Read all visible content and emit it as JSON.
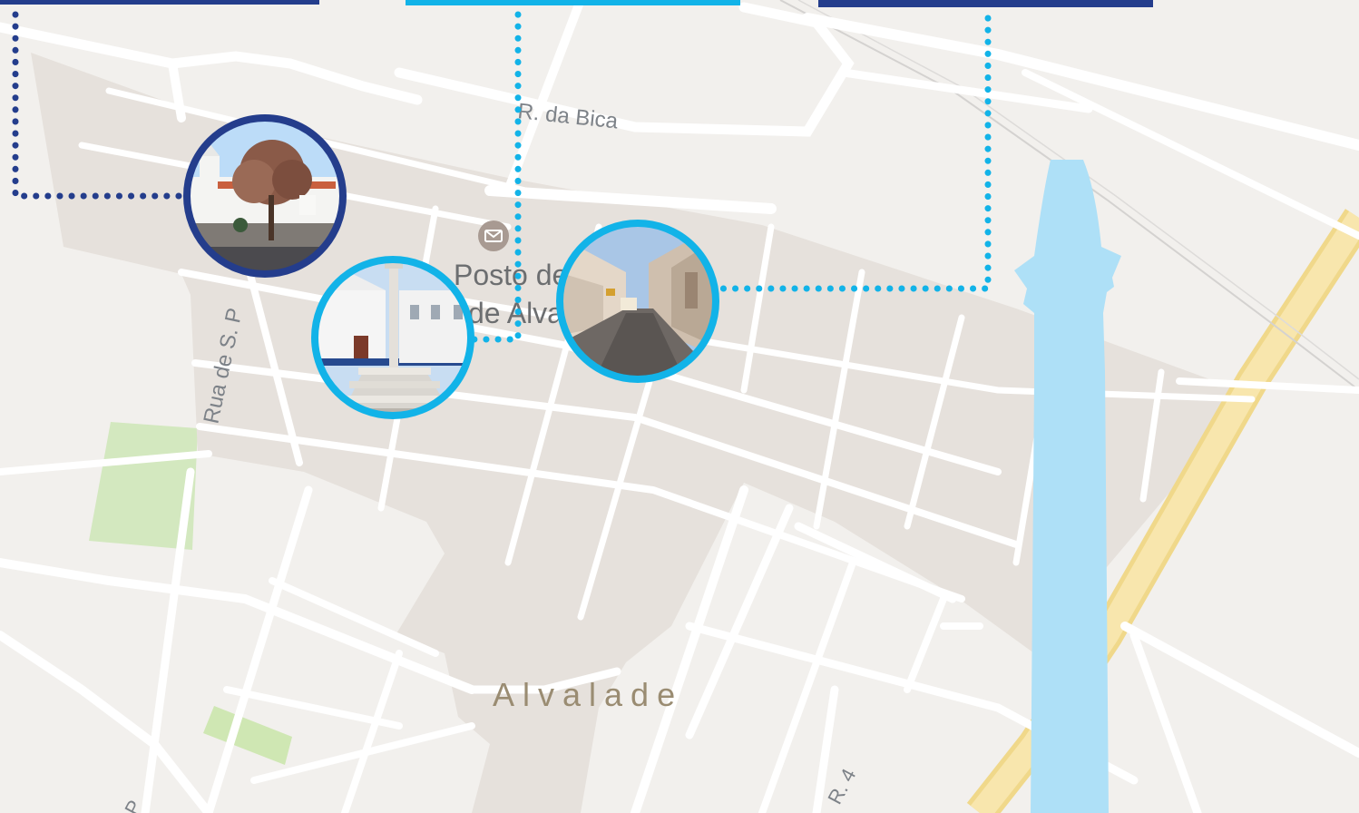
{
  "map": {
    "streets": {
      "rua_da_bica": "R. da Bica",
      "rua_de_s": "Rua de S. P",
      "rua_4": "R. 4",
      "partial_bottom_left": "P"
    },
    "poi": {
      "name_line1": "Posto de Correios",
      "name_line2": "de Alvalade",
      "icon": "mail-icon"
    },
    "town": "Alvalade"
  },
  "markers": [
    {
      "id": "church",
      "photo": "whitewashed church with tree",
      "ring_color": "#243d8c"
    },
    {
      "id": "pillory",
      "photo": "pillory column in square",
      "ring_color": "#12b3e8"
    },
    {
      "id": "street",
      "photo": "narrow village street",
      "ring_color": "#12b3e8"
    }
  ],
  "colors": {
    "dark_blue": "#243d8c",
    "cyan": "#12b3e8",
    "river": "#aee0f7",
    "highway": "#f8e4a6",
    "park": "#cfe7b3",
    "historic_zone": "#e6e1dc"
  }
}
